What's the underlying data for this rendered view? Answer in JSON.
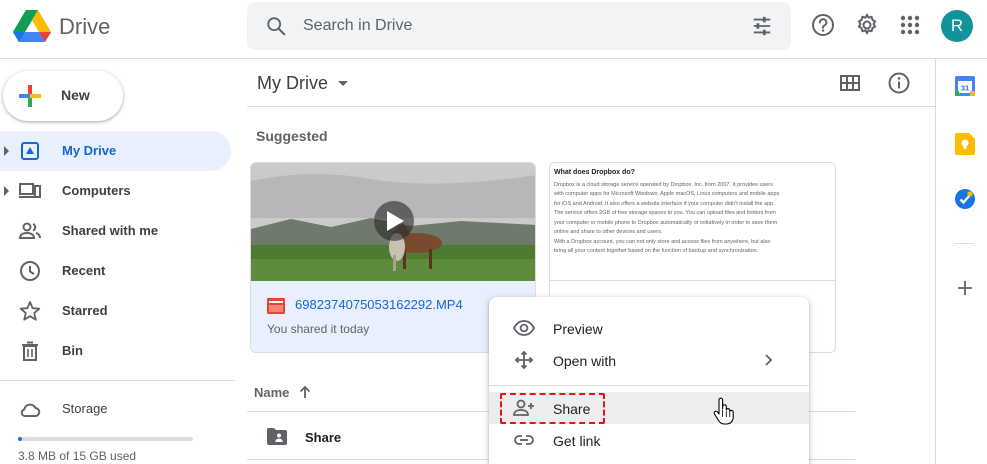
{
  "app": {
    "name": "Drive",
    "user_initial": "R",
    "colors": {
      "accent": "#1a73e8",
      "active_bg": "#e8f0fe",
      "avatar": "#12939a",
      "highlight": "#e8131a"
    }
  },
  "search": {
    "placeholder": "Search in Drive",
    "value": ""
  },
  "header_icons": [
    "search-icon",
    "tune-icon",
    "help-icon",
    "settings-icon",
    "apps-grid-icon"
  ],
  "sidebar": {
    "new_label": "New",
    "items": [
      {
        "label": "My Drive",
        "icon": "drive-icon",
        "active": true,
        "expandable": true
      },
      {
        "label": "Computers",
        "icon": "computer-icon",
        "active": false,
        "expandable": true
      },
      {
        "label": "Shared with me",
        "icon": "people-icon",
        "active": false,
        "expandable": false
      },
      {
        "label": "Recent",
        "icon": "clock-icon",
        "active": false,
        "expandable": false
      },
      {
        "label": "Starred",
        "icon": "star-icon",
        "active": false,
        "expandable": false
      },
      {
        "label": "Bin",
        "icon": "trash-icon",
        "active": false,
        "expandable": false
      }
    ],
    "storage_label": "Storage",
    "storage_text": "3.8 MB of 15 GB used",
    "storage_fraction": 0.002
  },
  "main": {
    "title": "My Drive",
    "suggested_label": "Suggested",
    "cards": [
      {
        "file_name": "6982374075053162292.MP4",
        "subtitle": "You shared it today",
        "type": "video"
      },
      {
        "type": "document",
        "doc_title": "What does Dropbox do?",
        "doc_lines": [
          "Dropbox is a cloud storage service operated by Dropbox, Inc. from 2007. It provides users",
          "with computer apps for Microsoft Windows, Apple macOS, Linux computers and mobile apps",
          "for iOS and Android. It also offers a website interface if your computer didn't install the app.",
          "The service offers 2GB of free storage spaces to you. You can upload files and folders from",
          "your computer or mobile phone to Dropbox automatically or initiatively in order to save them",
          "online and share to other devices and users.",
          "With a Dropbox account, you can not only store and access files from anywhere, but also",
          "bring all your content together based on the function of backup and synchronization."
        ]
      }
    ],
    "list_header": "Name",
    "rows": [
      {
        "name": "Share",
        "icon": "shared-folder-icon"
      }
    ]
  },
  "context_menu": {
    "items": [
      {
        "label": "Preview",
        "icon": "eye-icon"
      },
      {
        "label": "Open with",
        "icon": "move-icon",
        "submenu": true
      },
      {
        "label": "Share",
        "icon": "add-person-icon",
        "hovered": true
      },
      {
        "label": "Get link",
        "icon": "link-icon"
      }
    ]
  },
  "right_panel": {
    "icons": [
      "calendar-icon",
      "keep-icon",
      "tasks-icon",
      "add-icon"
    ],
    "calendar_day": "31"
  }
}
